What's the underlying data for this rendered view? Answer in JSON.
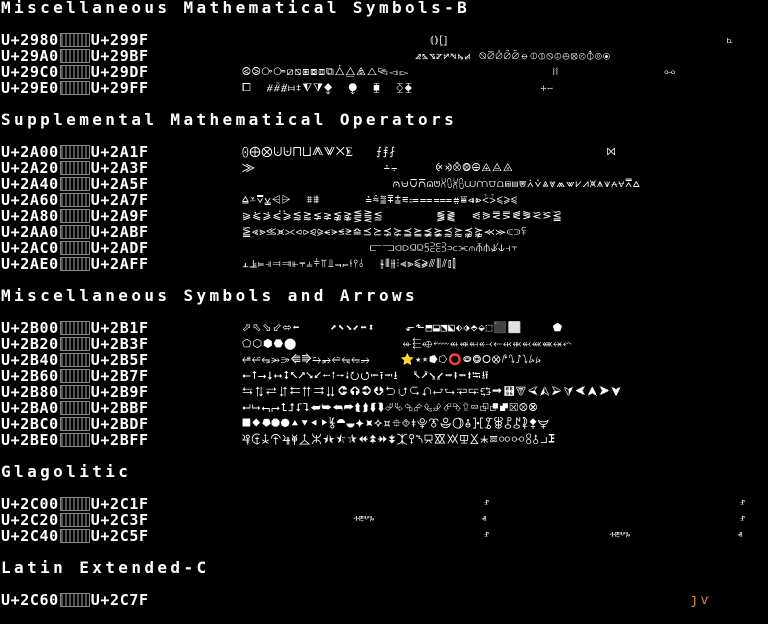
{
  "sections": [
    {
      "title": "Miscellaneous Mathematical Symbols-B",
      "rows": [
        {
          "start": "U+2980",
          "end": "U+299F",
          "glyphs": "                         ⦅⦆⦋⦌                                     ⦜"
        },
        {
          "start": "U+29A0",
          "end": "U+29BF",
          "glyphs": "                       ⦨⦩⦪⦫⦬⦭⦮⦯ ⦰⦱⦲⦳⦴⦵⦶⦷⦸⦹⦺⦻⦼⦽⦾⦿"
        },
        {
          "start": "U+29C0",
          "end": "U+29DF",
          "glyphs": "⧀⧁⧂⧃⧄⧅⧆⧇⧈⧉⧊⧋⧌⧍⧎⧏⧐                   ⧘⧙              ⧟"
        },
        {
          "start": "U+29E0",
          "end": "U+29FF",
          "glyphs": "⧠  ⧣⧤⧥⧦⧧⧨⧩⧪  ⧭  ⧯  ⧰⧱                 ⧾⧿"
        }
      ]
    },
    {
      "title": "Supplemental Mathematical Operators",
      "rows": [
        {
          "start": "U+2A00",
          "end": "U+2A1F",
          "glyphs": "⨀⨁⨂⨃⨄⨅⨆⨇⨈⨉⨊   ⨍⨎⨏                            ⨝"
        },
        {
          "start": "U+2A20",
          "end": "U+2A3F",
          "glyphs": "⨠                 ⨩⨪     ⨴⨵⨶⨷⨸⨹⨺⨻"
        },
        {
          "start": "U+2A40",
          "end": "U+2A5F",
          "glyphs": "                    ⩀⩁⩂⩃⩄⩅⩆⩇⩈⩉⩊⩋⩌⩍⩎⩏⩐⩑⩒⩓⩔⩕⩖⩗⩘⩙⩚⩛⩜⩝⩞⩟"
        },
        {
          "start": "U+2A60",
          "end": "U+2A7F",
          "glyphs": "⩠⩡⩢⩣⩤⩥  ⩨⩩      ⩮⩯⩰⩱⩲⩳⩴⩵⩶⩷⩸⩹⩺⩻⩼⩽⩾⩿"
        },
        {
          "start": "U+2A80",
          "end": "U+2A9F",
          "glyphs": "⪀⪁⪂⪃⪄⪅⪆⪇⪈⪉⪊⪋⪌⪍       ⪓⪔  ⪗⪘⪙⪚⪛⪜⪝⪞⪟"
        },
        {
          "start": "U+2AA0",
          "end": "U+2ABF",
          "glyphs": "⪠⪡⪢⪣⪤⪥⪦⪧⪨⪩⪪⪫⪬⪭⪮⪯⪰⪱⪲⪳⪴⪵⪶⪷⪸⪹⪺⪻⪼⪽⪾⪿"
        },
        {
          "start": "U+2AC0",
          "end": "U+2ADF",
          "glyphs": "                 ⫍⫎⫏⫐⫑⫒⫓⫔⫕⫖⫗⫘⫙⫚⫛⫝̸⫝⫞⫟"
        },
        {
          "start": "U+2AE0",
          "end": "U+2AFF",
          "glyphs": "⫠⫡⫢⫣⫤⫥⫦⫧⫨⫩⫪⫫⫬⫭⫮⫯⫰  ⫳⫴⫵⫶⫷⫸⫹⫺⫻⫼⫽⫾⫿"
        }
      ]
    },
    {
      "title": "Miscellaneous Symbols and Arrows",
      "rows": [
        {
          "start": "U+2B00",
          "end": "U+2B1F",
          "glyphs": "⬀⬁⬂⬃⬄⬅    ⬈⬉⬊⬋⬌⬍    ⬐⬑⬒⬓⬔⬕⬖⬗⬘⬙⬚⬛⬜    ⬟"
        },
        {
          "start": "U+2B20",
          "end": "U+2B3F",
          "glyphs": "⬠⬡⬢⬣⬤              ⬰⬱⬲⬳⬴⬵⬶⬷⬸⬹⬺⬻⬼⬽⬾⬿"
        },
        {
          "start": "U+2B40",
          "end": "U+2B5F",
          "glyphs": "⭀⭁⭂⭃⭄⭅⭆⭇⭈⭉⭊⭋⭌    ⭐⭑⭒⭓⭔⭕⭖⭗⭘⭙⭚⭛⭜⭝⭞⭟"
        },
        {
          "start": "U+2B60",
          "end": "U+2B7F",
          "glyphs": "⭠⭡⭢⭣⭤⭥⭦⭧⭨⭩⭪⭫⭬⭭⭮⭯⭰⭱⭲⭳  ⭶⭷⭸⭹⭺⭻⭼⭽⭾⭿"
        },
        {
          "start": "U+2B80",
          "end": "U+2B9F",
          "glyphs": "⮀⮁⮂⮃⮄⮅⮆⮇⮈⮉⮊⮋⮌⮍⮎⮏⮐⮑⮒⮓⮔⮕⮖⮗⮘⮙⮚⮛⮜⮝⮞⮟"
        },
        {
          "start": "U+2BA0",
          "end": "U+2BBF",
          "glyphs": "⮠⮡⮢⮣⮤⮥⮦⮧⮨⮩⮪⮫⮬⮭⮮⮯⮰⮱⮲⮳⮴⮵⮶⮷⮸⮹⮺⮻⮼⮽⮾⮿"
        },
        {
          "start": "U+2BC0",
          "end": "U+2BDF",
          "glyphs": "⯀⯁⯂⯃⯄⯅⯆⯇⯈⯉⯊⯋⯌⯍⯎⯏⯐⯑⯒⯓⯔⯕⯖⯗⯘⯙⯚⯛⯜⯝⯞⯟"
        },
        {
          "start": "U+2BE0",
          "end": "U+2BFF",
          "glyphs": "⯠⯡⯢⯣⯤⯥⯦⯧⯨⯩⯪⯫⯬⯭⯮⯯⯰⯱⯲⯳⯴⯵⯶⯷⯸⯹⯺⯻⯼⯽⯾⯿"
        }
      ]
    },
    {
      "title": "Glagolitic",
      "rows": [
        {
          "start": "U+2C00",
          "end": "U+2C1F",
          "glyphs": ""
        },
        {
          "start": "U+2C20",
          "end": "U+2C3F",
          "glyphs": ""
        },
        {
          "start": "U+2C40",
          "end": "U+2C5F",
          "glyphs": ""
        }
      ]
    },
    {
      "title": "Latin Extended-C",
      "rows": [
        {
          "start": "U+2C60",
          "end": "U+2C7F",
          "glyphs": ""
        }
      ]
    }
  ],
  "glagolitic_fragments": [
    {
      "text": "ⱀ",
      "row": 0
    },
    {
      "text": "ⱀ",
      "row": 0
    },
    {
      "text": "ⰰⰱⰲⰳ",
      "row": 1
    },
    {
      "text": "ⱏ",
      "row": 1
    },
    {
      "text": "ⱀ",
      "row": 1
    },
    {
      "text": "ⱀ",
      "row": 2
    },
    {
      "text": "ⰰⰱⰲⰳ",
      "row": 2
    },
    {
      "text": "ⱏ",
      "row": 2
    }
  ],
  "latin_extended_tail": "ȷⱱ",
  "colors": {
    "background": "#000000",
    "text": "#ffffff",
    "accent": "#d08a3a",
    "accent_red": "#e05a2a"
  }
}
